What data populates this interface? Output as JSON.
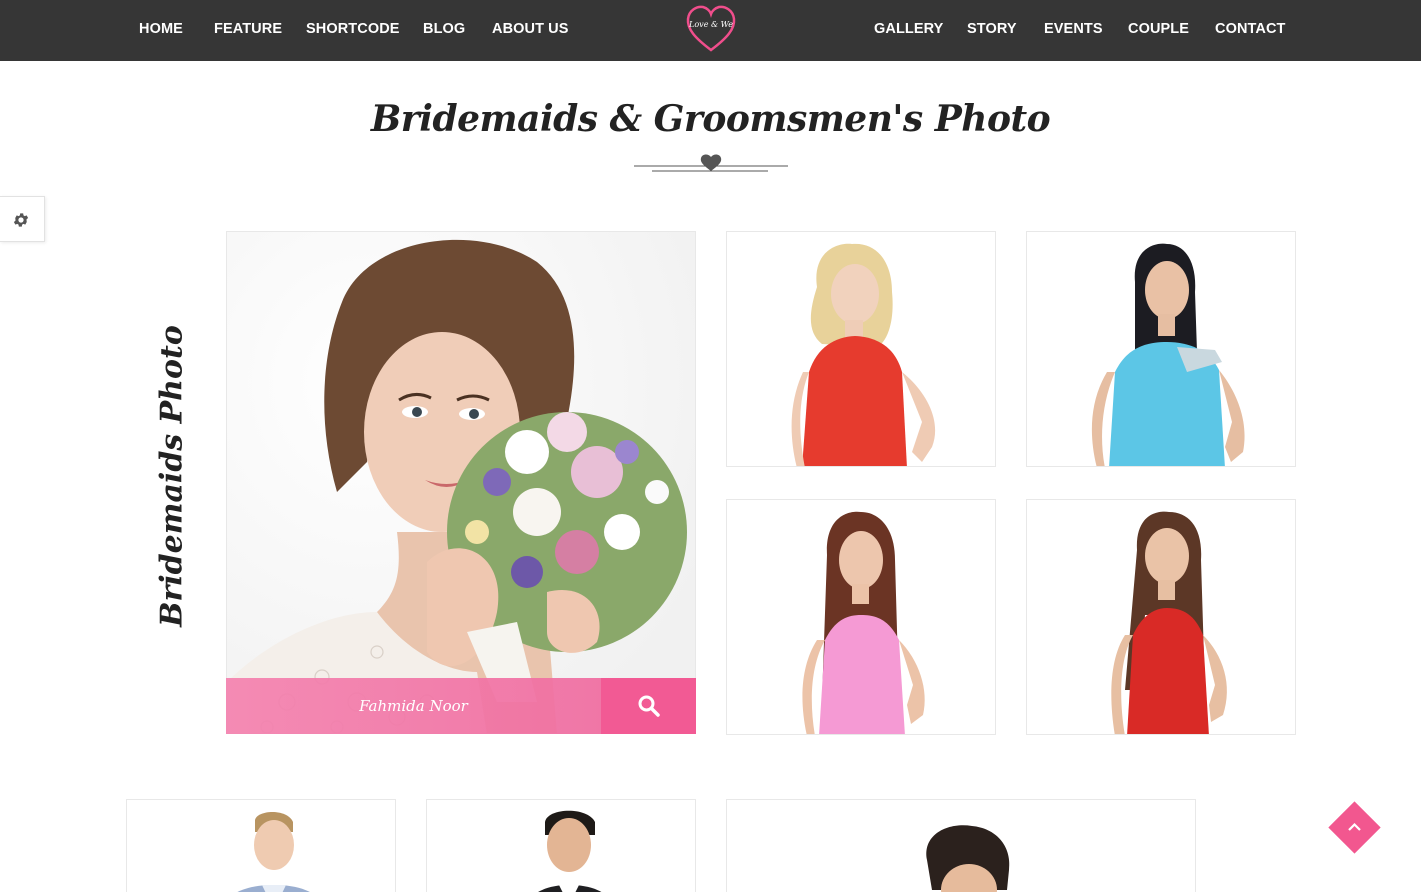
{
  "nav": {
    "left_items": [
      "HOME",
      "FEATURE",
      "SHORTCODE",
      "BLOG",
      "ABOUT US"
    ],
    "right_items": [
      "GALLERY",
      "STORY",
      "EVENTS",
      "COUPLE",
      "CONTACT"
    ],
    "logo_text": "Love & We"
  },
  "section": {
    "title": "Bridemaids & Groomsmen's Photo",
    "vertical_label": "Bridemaids Photo"
  },
  "featured": {
    "name": "Fahmida Noor",
    "search_icon": "search-icon"
  },
  "colors": {
    "nav_bg": "#363636",
    "accent_pink": "#f2578f",
    "caption_pink": "#f482af",
    "text_dark": "#222222"
  },
  "icons": {
    "settings": "gear-icon",
    "back_to_top": "chevron-up-icon",
    "divider": "heart-icon",
    "logo": "heart-logo-icon"
  }
}
